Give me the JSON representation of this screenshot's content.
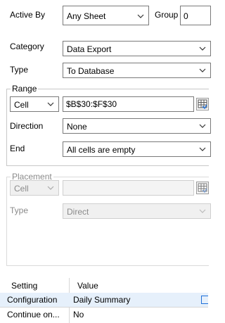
{
  "header": {
    "active_by_label": "Active By",
    "active_by_value": "Any Sheet",
    "group_label": "Group",
    "group_value": "0"
  },
  "main": {
    "category_label": "Category",
    "category_value": "Data Export",
    "type_label": "Type",
    "type_value": "To Database"
  },
  "range": {
    "title": "Range",
    "cell_mode": "Cell",
    "address": "$B$30:$F$30",
    "direction_label": "Direction",
    "direction_value": "None",
    "end_label": "End",
    "end_value": "All cells are empty"
  },
  "placement": {
    "title": "Placement",
    "cell_mode": "Cell",
    "address": "",
    "type_label": "Type",
    "type_value": "Direct"
  },
  "settings": {
    "col_setting": "Setting",
    "col_value": "Value",
    "rows": [
      {
        "setting": "Configuration",
        "value": "Daily Summary"
      },
      {
        "setting": "Continue on...",
        "value": "No"
      }
    ]
  },
  "colors": {
    "selected_row_bg": "#e6f0fb",
    "border": "#7a7a7a",
    "disabled_text": "#8a8a8a",
    "accent": "#1e6fd9"
  },
  "icons": {
    "dropdown": "chevron-down-icon",
    "range_picker": "range-picker-icon",
    "ellipsis": "ellipsis-button-icon"
  }
}
